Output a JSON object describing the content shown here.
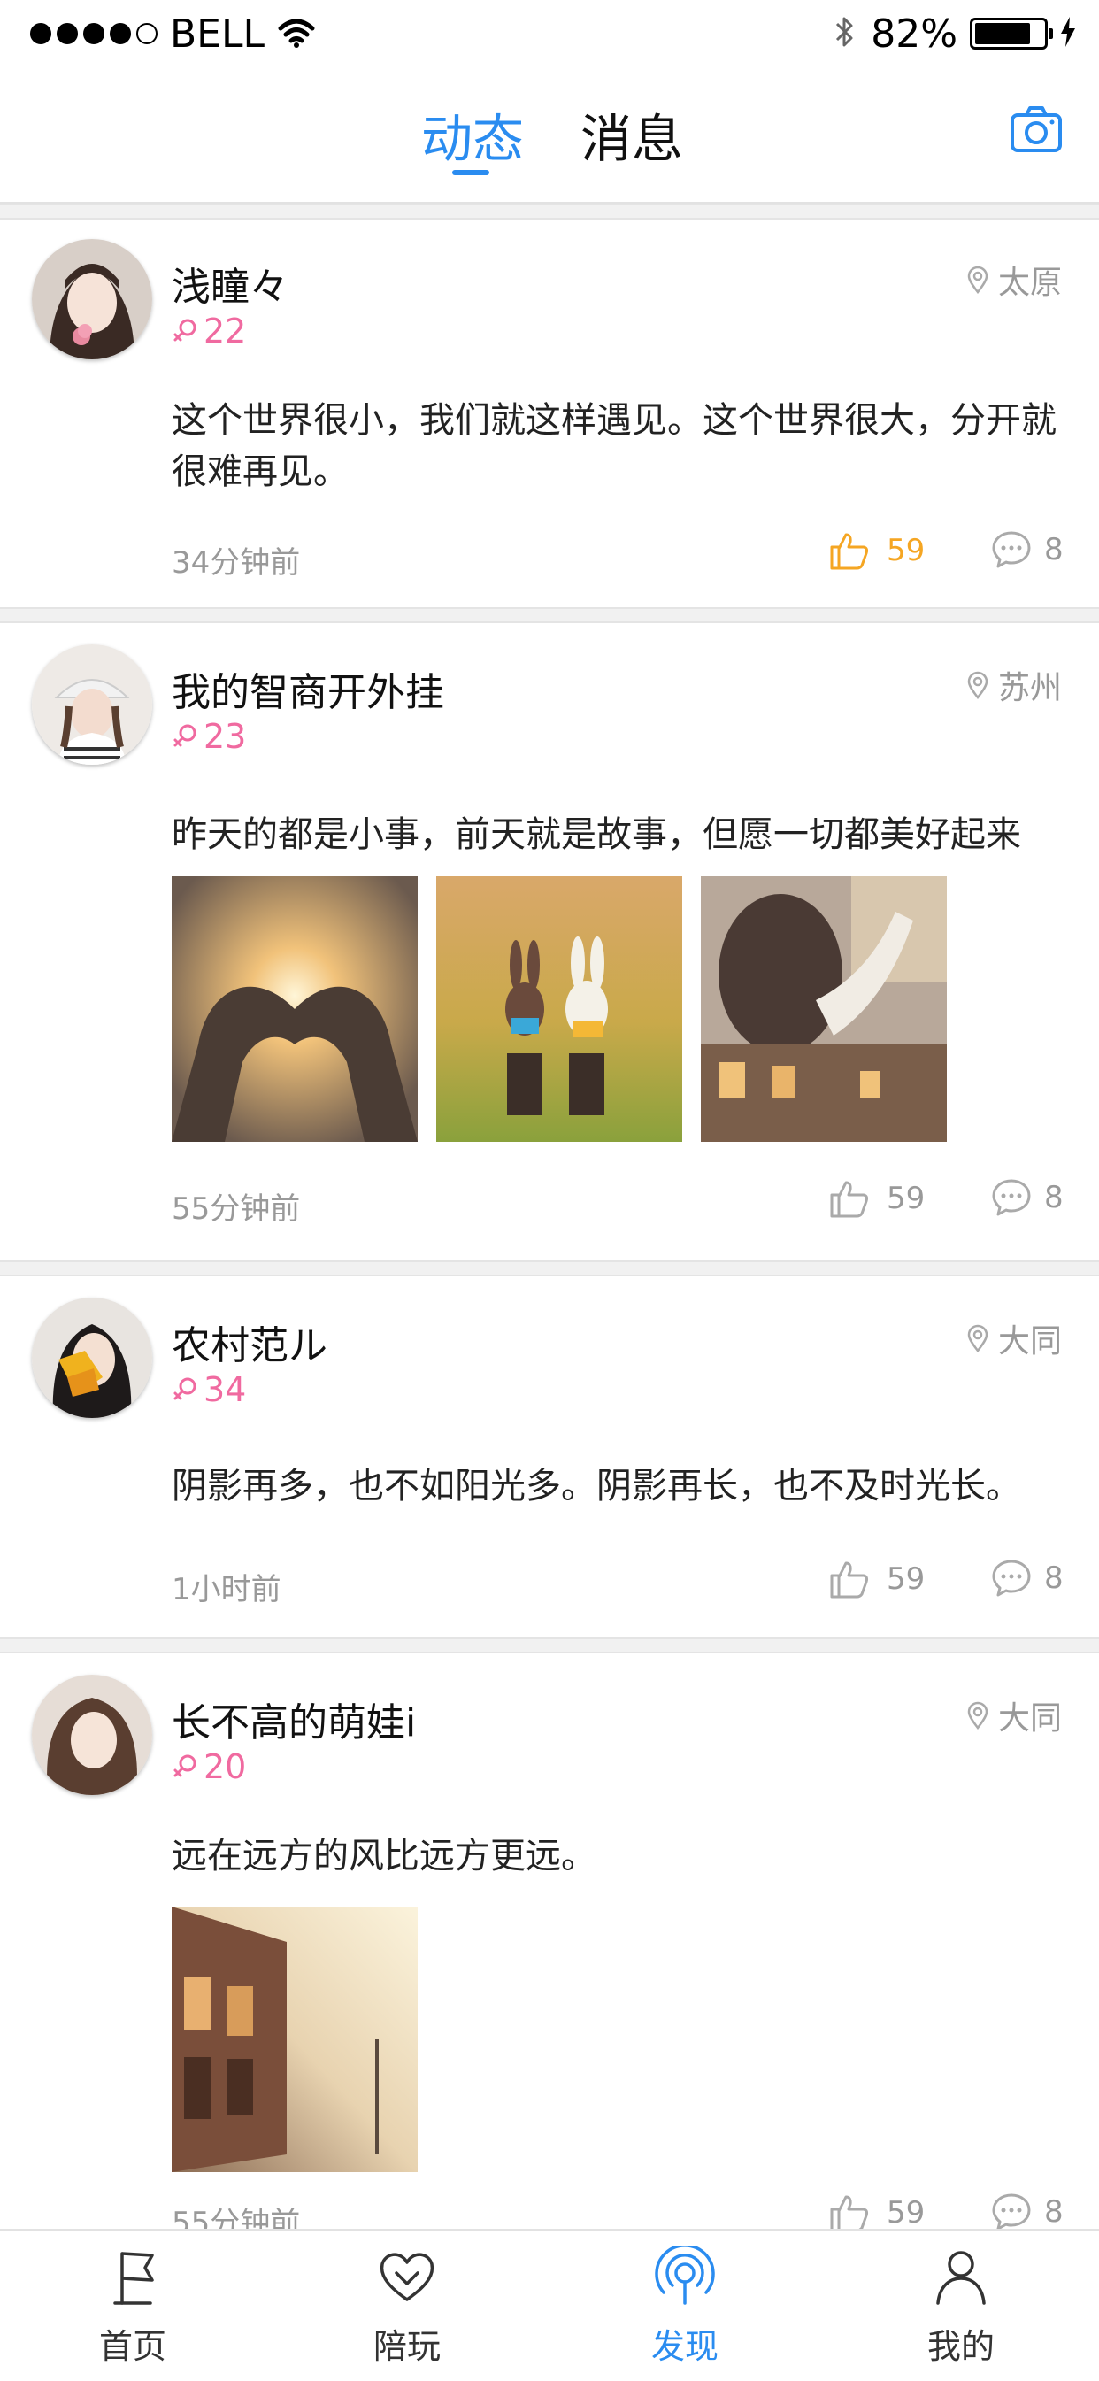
{
  "status_bar": {
    "carrier": "BELL",
    "battery_percent": "82%",
    "battery_level": 0.82,
    "signal_bars_filled": 4,
    "signal_bars_total": 5
  },
  "header": {
    "tabs": [
      {
        "label": "动态",
        "active": true
      },
      {
        "label": "消息",
        "active": false
      }
    ],
    "accent_color": "#2a8cf0",
    "camera_icon": "camera-icon"
  },
  "posts": [
    {
      "username": "浅瞳々",
      "location": "太原",
      "age": "22",
      "text": "这个世界很小，我们就这样遇见。这个世界很大，分开就很难再见。",
      "time": "34分钟前",
      "likes": "59",
      "liked": true,
      "comments": "8",
      "photos": []
    },
    {
      "username": "我的智商开外挂",
      "location": "苏州",
      "age": "23",
      "text": "昨天的都是小事，前天就是故事，但愿一切都美好起来",
      "time": "55分钟前",
      "likes": "59",
      "liked": false,
      "comments": "8",
      "photos": [
        "heart-hands-photo",
        "bunny-figures-photo",
        "girl-window-photo"
      ]
    },
    {
      "username": "农村范ル",
      "location": "大同",
      "age": "34",
      "text": "阴影再多，也不如阳光多。阴影再长，也不及时光长。",
      "time": "1小时前",
      "likes": "59",
      "liked": false,
      "comments": "8",
      "photos": []
    },
    {
      "username": "长不高的萌娃i",
      "location": "大同",
      "age": "20",
      "text": "远在远方的风比远方更远。",
      "time": "55分钟前",
      "likes": "59",
      "liked": false,
      "comments": "8",
      "photos": [
        "street-photo"
      ]
    }
  ],
  "bottom_nav": {
    "items": [
      {
        "label": "首页",
        "icon": "flag-icon",
        "active": false
      },
      {
        "label": "陪玩",
        "icon": "heart-icon",
        "active": false
      },
      {
        "label": "发现",
        "icon": "broadcast-icon",
        "active": true
      },
      {
        "label": "我的",
        "icon": "person-icon",
        "active": false
      }
    ]
  },
  "colors": {
    "accent": "#2a8cf0",
    "like_active": "#f5a623",
    "gender_pink": "#f06aa0",
    "muted_text": "#999999"
  }
}
